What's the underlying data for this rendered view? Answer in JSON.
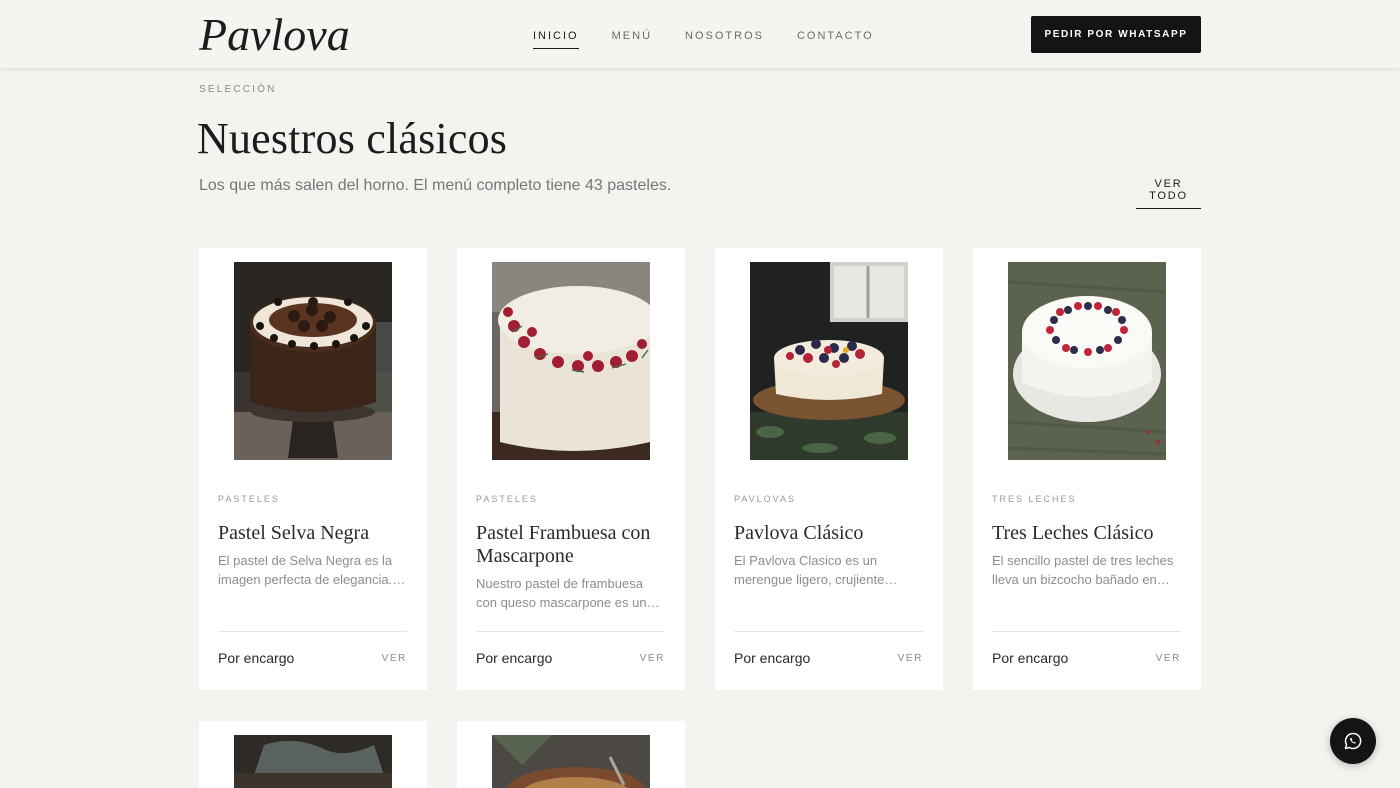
{
  "brand": {
    "logo_text": "Pavlova"
  },
  "nav": {
    "items": [
      {
        "label": "INICIO",
        "active": true
      },
      {
        "label": "MENÚ",
        "active": false
      },
      {
        "label": "NOSOTROS",
        "active": false
      },
      {
        "label": "CONTACTO",
        "active": false
      }
    ],
    "cta_label": "PEDIR POR WHATSAPP"
  },
  "section": {
    "eyebrow": "SELECCIÓN",
    "title": "Nuestros clásicos",
    "subtitle": "Los que más salen del horno. El menú completo tiene 43 pasteles.",
    "see_all_label": "VER TODO"
  },
  "products": [
    {
      "category": "PASTELES",
      "name": "Pastel Selva Negra",
      "description": "El pastel de Selva Negra es la imagen perfecta de elegancia. Un bizcocho de chocolate con crema y cerezas.",
      "availability": "Por encargo",
      "view_label": "VER"
    },
    {
      "category": "PASTELES",
      "name": "Pastel Frambuesa con Mascarpone",
      "description": "Nuestro pastel de frambuesa con queso mascarpone es un favorito de la casa, suave y fresco.",
      "availability": "Por encargo",
      "view_label": "VER"
    },
    {
      "category": "PAVLOVAS",
      "name": "Pavlova Clásico",
      "description": "El Pavlova Clasico es un merengue ligero, crujiente afuera y suave por dentro, con frutos rojos.",
      "availability": "Por encargo",
      "view_label": "VER"
    },
    {
      "category": "TRES LECHES",
      "name": "Tres Leches Clásico",
      "description": "El sencillo pastel de tres leches lleva un bizcocho bañado en una mezcla de tres leches.",
      "availability": "Por encargo",
      "view_label": "VER"
    }
  ],
  "fab": {
    "icon": "whatsapp-icon"
  }
}
